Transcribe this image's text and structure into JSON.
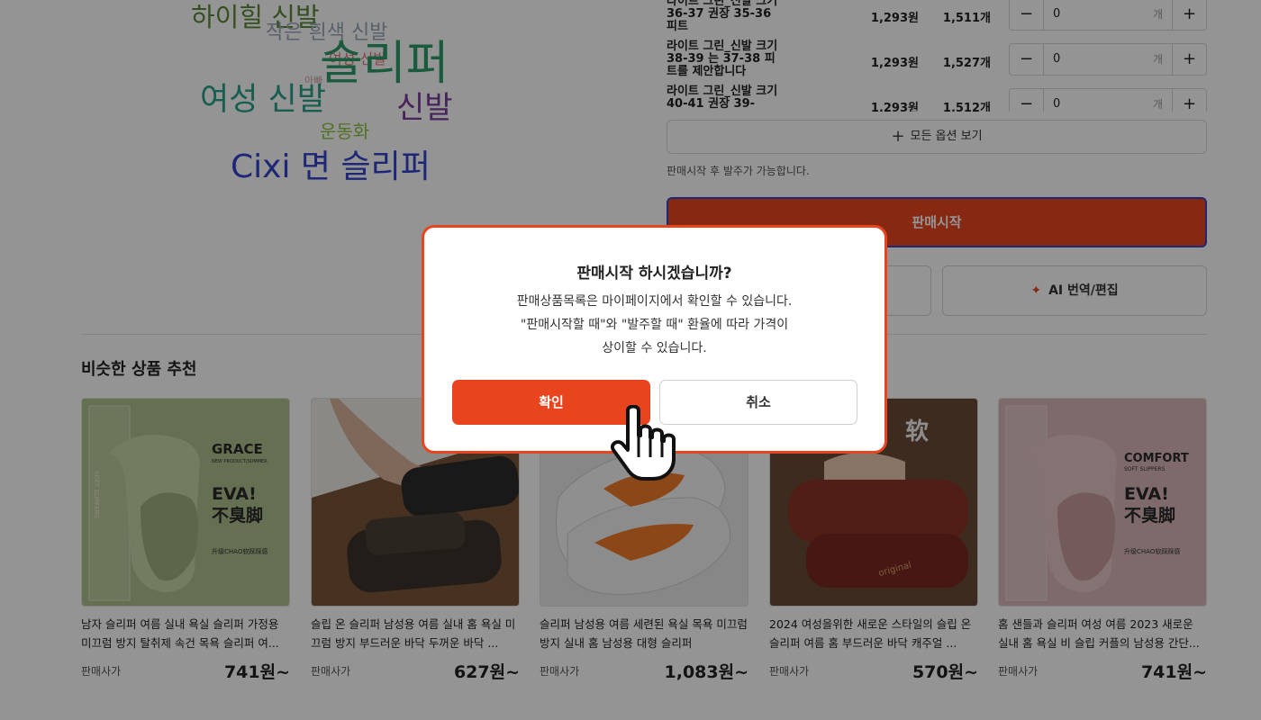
{
  "word_cloud": [
    {
      "text": "하이힐 신발",
      "color": "#5a8a3a"
    },
    {
      "text": "작은 흰색 신발",
      "color": "#9aa8b8"
    },
    {
      "text": "슬리퍼",
      "color": "#2e9e6a"
    },
    {
      "text": "여성 신발",
      "color": "#2aa28a"
    },
    {
      "text": "신발",
      "color": "#7a3f9c"
    },
    {
      "text": "운동화",
      "color": "#8cc63f"
    },
    {
      "text": "Cixi 면 슬리퍼",
      "color": "#3344cc"
    },
    {
      "text": "여성 신발",
      "color": "#e07a7a"
    },
    {
      "text": "아빠",
      "color": "#c9a0a0"
    }
  ],
  "options": {
    "rows": [
      {
        "name": "라이트 그린_신발 크기 36-37 권장 35-36 피트",
        "price": "1,293원",
        "stock": "1,511개",
        "qty": "0",
        "unit": "개"
      },
      {
        "name": "라이트 그린_신발 크기 38-39 는 37-38 피트를 제안합니다",
        "price": "1,293원",
        "stock": "1,527개",
        "qty": "0",
        "unit": "개"
      },
      {
        "name": "라이트 그린_신발 크기 40-41 권장 39-",
        "price": "1,293원",
        "stock": "1,512개",
        "qty": "0",
        "unit": "개"
      }
    ],
    "minus": "−",
    "plus": "+",
    "show_all": "모든 옵션 보기",
    "note": "판매시작 후 발주가 가능합니다."
  },
  "actions": {
    "start_sale": "판매시작",
    "ai_translate": "AI 번역/편집"
  },
  "recommend": {
    "title": "비슷한 상품 추천",
    "items": [
      {
        "title": "남자 슬리퍼 여름 실내 욕실 슬리퍼 가정용 미끄럼 방지 탈취제 속건 목욕 슬리퍼 여...",
        "seller": "판매사가",
        "price": "741원~",
        "brand": "GRACE",
        "sub": "NEW PRODUCT/SUMMER",
        "line1": "EVA!",
        "line2": "不臭脚",
        "line3": "升级CHAO软踩踩感",
        "side": "SOFT SLIPPERS",
        "bg": "#aebf8e",
        "shoe": "#c7d4a8"
      },
      {
        "title": "슬립 온 슬리퍼 남성용 여름 실내 홈 욕실 미끄럼 방지 부드러운 바닥 두꺼운 바닥 ...",
        "seller": "판매사가",
        "price": "627원~",
        "bg": "#7a5538",
        "shoe": "#3c332c"
      },
      {
        "title": "슬리퍼 남성용 여름 세련된 욕실 목욕 미끄럼 방지 실내 홈 남성용 대형 슬리퍼",
        "seller": "판매사가",
        "price": "1,083원~",
        "bg": "#e8e8e8",
        "shoe": "#f2f2f2"
      },
      {
        "title": "2024 여성을위한 새로운 스타일의 슬립 온 슬리퍼 여름 홈 부드러운 바닥 캐주얼 ...",
        "seller": "판매사가",
        "price": "570원~",
        "big": "软",
        "tag": "original",
        "bg": "#6a4a36",
        "shoe": "#7a2a22"
      },
      {
        "title": "홈 샌들과 슬리퍼 여성 여름 2023 새로운 실내 홈 욕실 비 슬립 커플의 남성용 간단...",
        "seller": "판매사가",
        "price": "741원~",
        "brand": "COMFORT",
        "sub": "SOFT SLIPPERS",
        "line1": "EVA!",
        "line2": "不臭脚",
        "line3": "升级CHAO软踩踩感",
        "side": "SOFT SLIPPERS",
        "bg": "#d9b7b7",
        "shoe": "#e6c4c4"
      }
    ]
  },
  "modal": {
    "title": "판매시작 하시겠습니까?",
    "line1": "판매상품목록은 마이페이지에서 확인할 수 있습니다.",
    "line2": "\"판매시작할 때\"와 \"발주할 때\" 환율에 따라 가격이",
    "line3": "상이할 수 있습니다.",
    "confirm": "확인",
    "cancel": "취소"
  },
  "colors": {
    "accent": "#e8451f",
    "start_border": "#3a47c9"
  },
  "icons": {
    "cursor": "hand-pointer-icon",
    "plus": "plus-icon",
    "sparkle": "sparkle-icon"
  }
}
